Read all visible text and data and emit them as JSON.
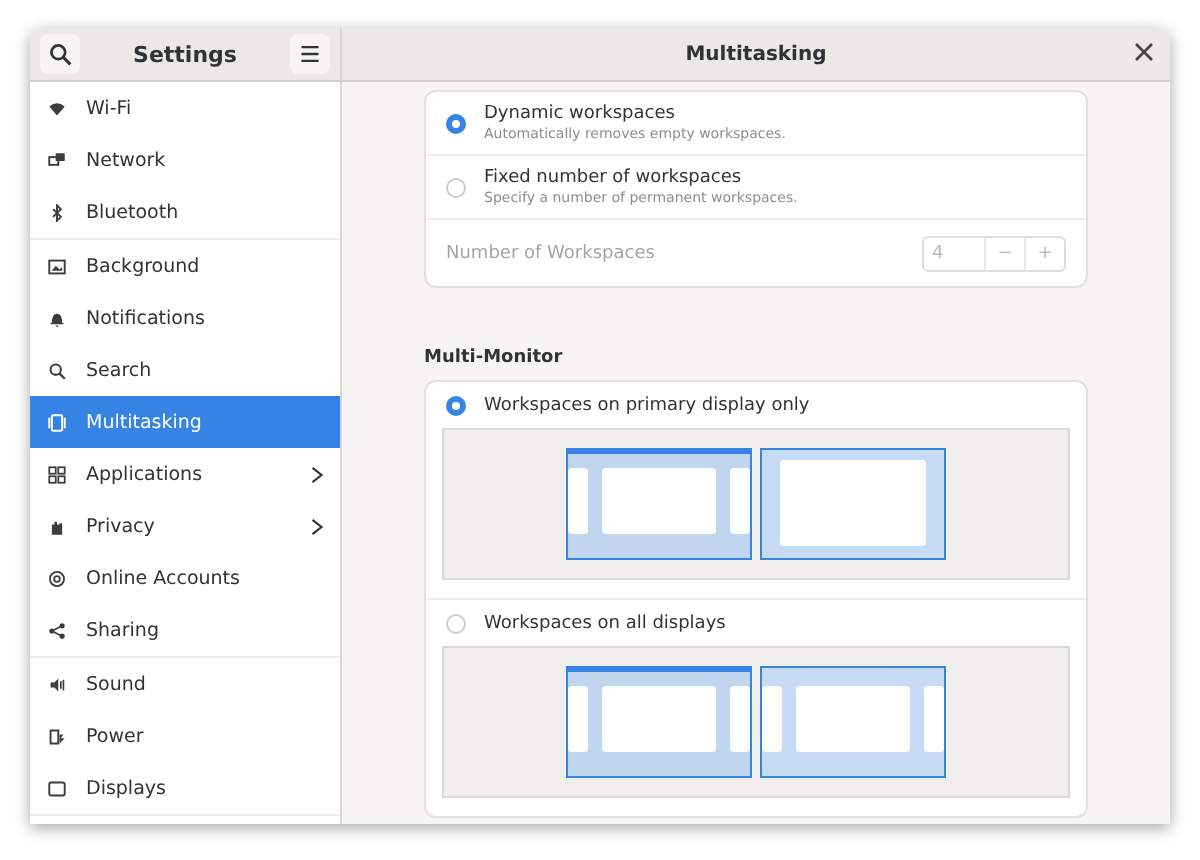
{
  "sidebar": {
    "title": "Settings",
    "groups": [
      {
        "items": [
          {
            "label": "Wi-Fi",
            "selected": false,
            "has_submenu": false
          },
          {
            "label": "Network",
            "selected": false,
            "has_submenu": false
          },
          {
            "label": "Bluetooth",
            "selected": false,
            "has_submenu": false
          }
        ]
      },
      {
        "items": [
          {
            "label": "Background",
            "selected": false,
            "has_submenu": false
          },
          {
            "label": "Notifications",
            "selected": false,
            "has_submenu": false
          },
          {
            "label": "Search",
            "selected": false,
            "has_submenu": false
          },
          {
            "label": "Multitasking",
            "selected": true,
            "has_submenu": false
          },
          {
            "label": "Applications",
            "selected": false,
            "has_submenu": true
          },
          {
            "label": "Privacy",
            "selected": false,
            "has_submenu": true
          },
          {
            "label": "Online Accounts",
            "selected": false,
            "has_submenu": false
          },
          {
            "label": "Sharing",
            "selected": false,
            "has_submenu": false
          }
        ]
      },
      {
        "items": [
          {
            "label": "Sound",
            "selected": false,
            "has_submenu": false
          },
          {
            "label": "Power",
            "selected": false,
            "has_submenu": false
          },
          {
            "label": "Displays",
            "selected": false,
            "has_submenu": false
          }
        ]
      }
    ]
  },
  "window": {
    "title": "Multitasking"
  },
  "workspaces": {
    "options": [
      {
        "title": "Dynamic workspaces",
        "subtitle": "Automatically removes empty workspaces.",
        "selected": true
      },
      {
        "title": "Fixed number of workspaces",
        "subtitle": "Specify a number of permanent workspaces.",
        "selected": false
      }
    ],
    "count": {
      "label": "Number of Workspaces",
      "value": "4",
      "decrement": "−",
      "increment": "+",
      "disabled": true
    }
  },
  "multi_monitor": {
    "heading": "Multi-Monitor",
    "options": [
      {
        "label": "Workspaces on primary display only",
        "selected": true
      },
      {
        "label": "Workspaces on all displays",
        "selected": false
      }
    ]
  }
}
